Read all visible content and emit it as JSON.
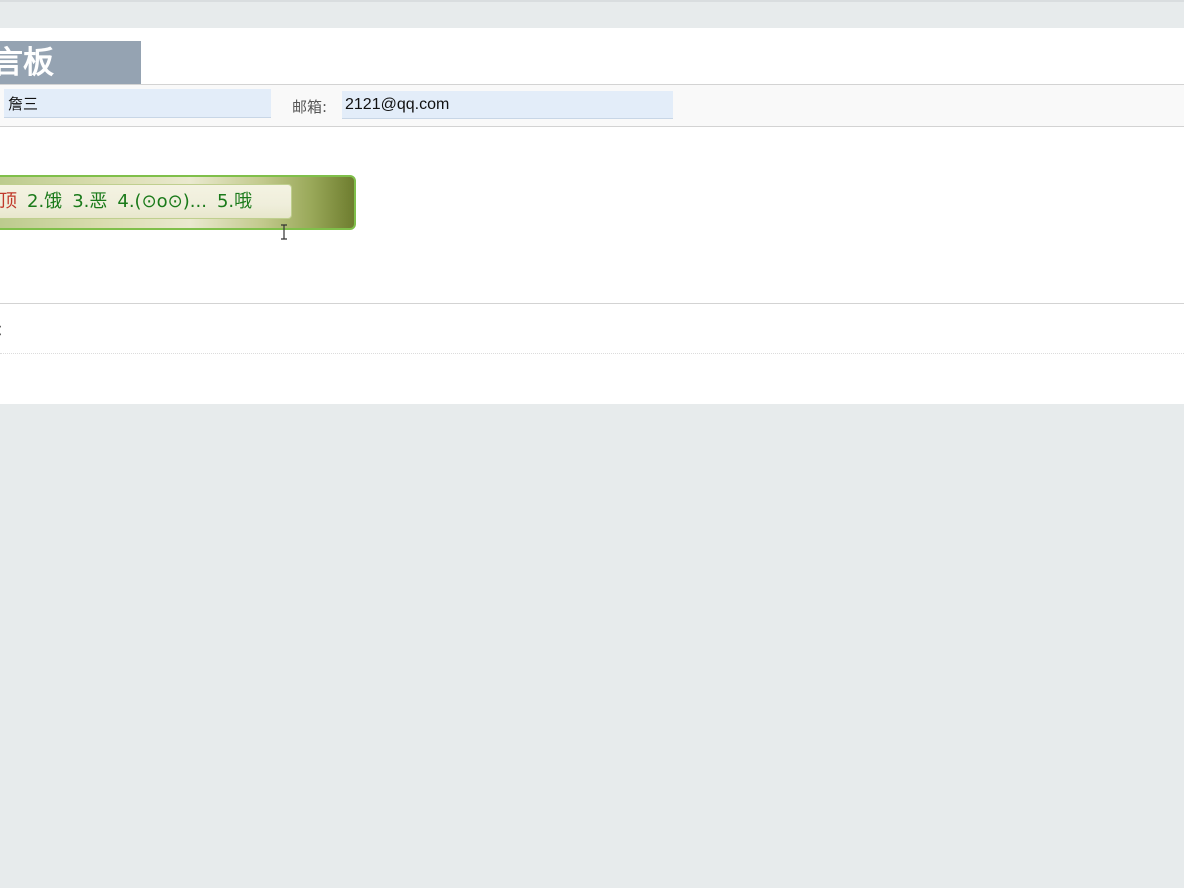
{
  "board": {
    "title": "言板"
  },
  "form": {
    "name_value": "詹三",
    "email_label": "邮箱:",
    "email_value": "2121@qq.com"
  },
  "emoji_bar": {
    "items": [
      "顶",
      "2.饿",
      "3.恶",
      "4.(⊙o⊙)...",
      "5.哦"
    ]
  },
  "message_list": {
    "item_fragment": "："
  },
  "colors": {
    "title_bg": "#95a3b2",
    "input_bg": "#e3edf9",
    "emoji_text": "#1a7a1a",
    "emoji_first": "#c0392b",
    "page_bg": "#e7ebec"
  }
}
